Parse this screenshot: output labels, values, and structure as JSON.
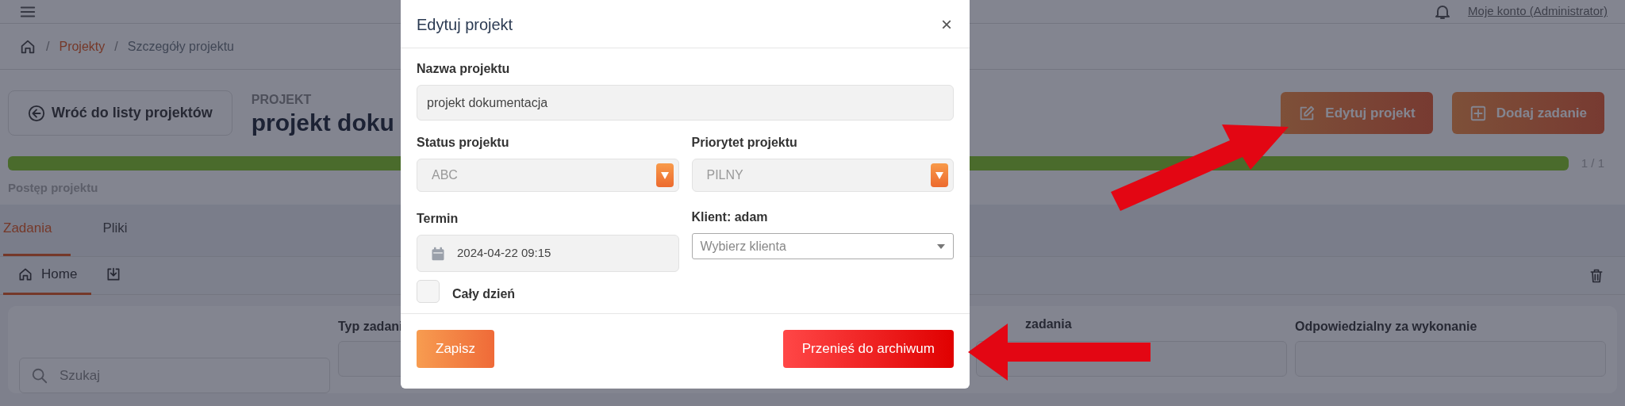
{
  "topbar": {
    "account": "Moje konto (Administrator)"
  },
  "breadcrumb": [
    {
      "separator": "/",
      "label": "Projekty",
      "link": true
    },
    {
      "separator": "/",
      "label": "Szczegóły projektu",
      "link": false
    }
  ],
  "back_button": "Wróć do listy projektów",
  "project_label": "PROJEKT",
  "project_title": "projekt doku",
  "header_buttons": [
    {
      "kind": "edit",
      "label": "Edytuj projekt"
    },
    {
      "kind": "add",
      "label": "Dodaj zadanie"
    }
  ],
  "progress": {
    "level": 1,
    "reading": "1 / 1",
    "label": "Postęp projektu"
  },
  "tabs": [
    {
      "label": "Zadania",
      "selected": true
    },
    {
      "label": "Pliki",
      "selected": false
    }
  ],
  "subtabs": [
    {
      "kind": "home",
      "label": "Home",
      "selected": true
    },
    {
      "kind": "download",
      "selected": false
    }
  ],
  "filters": {
    "search_placeholder": "Szukaj",
    "fields": [
      {
        "label": "Typ zadani"
      },
      {
        "label": "zadania"
      },
      {
        "label": "Odpowiedzialny za wykonanie"
      }
    ]
  },
  "modal": {
    "title": "Edytuj projekt",
    "close": "×",
    "name": {
      "label": "Nazwa projektu",
      "value": "projekt dokumentacja"
    },
    "status": {
      "label": "Status projektu",
      "value": "ABC"
    },
    "priority": {
      "label": "Priorytet projektu",
      "value": "PILNY"
    },
    "deadline": {
      "label": "Termin",
      "value": "2024-04-22 09:15"
    },
    "client": {
      "label": "Klient: adam",
      "placeholder": "Wybierz klienta"
    },
    "all_day": {
      "label": "Cały dzień",
      "checked": false
    },
    "save_button": "Zapisz",
    "archive_button": "Przenieś do archiwum"
  }
}
